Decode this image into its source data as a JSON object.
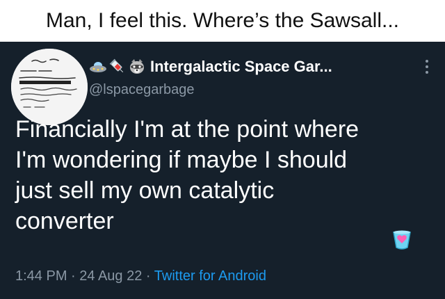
{
  "caption": "Man, I feel this. Where’s the Sawsall...",
  "tweet": {
    "display_name": "Intergalactic Space Gar...",
    "handle": "@lspacegarbage",
    "name_emojis": [
      "ufo-icon",
      "syringe-icon",
      "raccoon-icon"
    ],
    "text_lines": [
      "Financially I'm at the point where",
      "I'm wondering if maybe I should",
      "just sell my own catalytic",
      "converter"
    ],
    "time": "1:44 PM",
    "date": "24 Aug 22",
    "separator": " · ",
    "source": "Twitter for Android",
    "badge_icon": "heart-cup-icon"
  },
  "colors": {
    "background": "#15202b",
    "text": "#ffffff",
    "secondary": "#8b98a5",
    "link": "#1d9bf0"
  }
}
